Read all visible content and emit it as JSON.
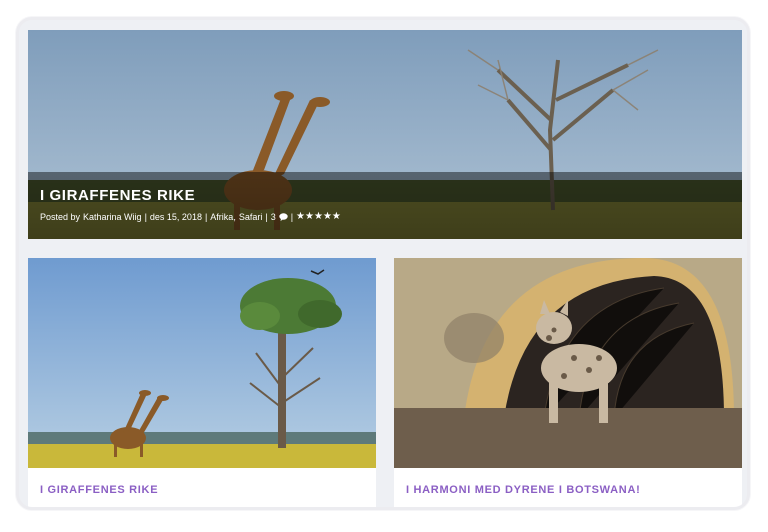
{
  "featured": {
    "title": "I GIRAFFENES RIKE",
    "meta_prefix": "Posted by",
    "author": "Katharina Wiig",
    "sep": "|",
    "date": "des 15, 2018",
    "category_1": "Afrika",
    "category_sep": ",",
    "category_2": "Safari",
    "comments": "3",
    "rating_stars": "★★★★★"
  },
  "cards": [
    {
      "title": "I GIRAFFENES RIKE"
    },
    {
      "title": "I HARMONI MED DYRENE I BOTSWANA!"
    }
  ],
  "colors": {
    "accent": "#8b5fc4",
    "frame_border": "#ececf0"
  }
}
